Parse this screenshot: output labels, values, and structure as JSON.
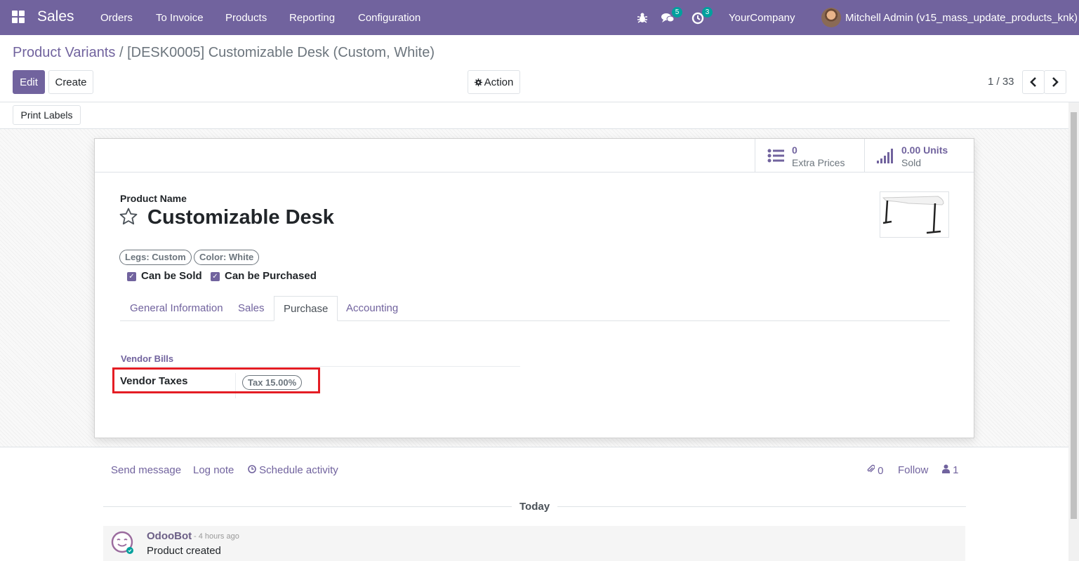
{
  "navbar": {
    "app_name": "Sales",
    "menu": [
      "Orders",
      "To Invoice",
      "Products",
      "Reporting",
      "Configuration"
    ],
    "messages_count": "5",
    "activities_count": "3",
    "company": "YourCompany",
    "user": "Mitchell Admin (v15_mass_update_products_knk)",
    "color": "#71639e"
  },
  "breadcrumb": {
    "parent": "Product Variants",
    "separator": "/",
    "current": "[DESK0005] Customizable Desk (Custom, White)"
  },
  "buttons": {
    "edit": "Edit",
    "create": "Create",
    "action": "Action",
    "print_labels": "Print Labels"
  },
  "pager": {
    "value": "1 / 33"
  },
  "stat_buttons": {
    "extra_prices_value": "0",
    "extra_prices_label": "Extra Prices",
    "units_sold_value": "0.00 Units",
    "units_sold_label": "Sold"
  },
  "product": {
    "name_label": "Product Name",
    "name": "Customizable Desk",
    "tags": [
      "Legs: Custom",
      "Color: White"
    ],
    "can_be_sold_label": "Can be Sold",
    "can_be_purchased_label": "Can be Purchased"
  },
  "tabs": [
    "General Information",
    "Sales",
    "Purchase",
    "Accounting"
  ],
  "active_tab": "Purchase",
  "purchase": {
    "group_title": "Vendor Bills",
    "vendor_taxes_label": "Vendor Taxes",
    "vendor_tax_tag": "Tax 15.00%"
  },
  "chatter": {
    "send_message": "Send message",
    "log_note": "Log note",
    "schedule_activity": "Schedule activity",
    "attachments_count": "0",
    "follow": "Follow",
    "followers_count": "1",
    "today": "Today",
    "message": {
      "author": "OdooBot",
      "date": "- 4 hours ago",
      "body": "Product created"
    }
  },
  "highlight_color": "#e41d24"
}
